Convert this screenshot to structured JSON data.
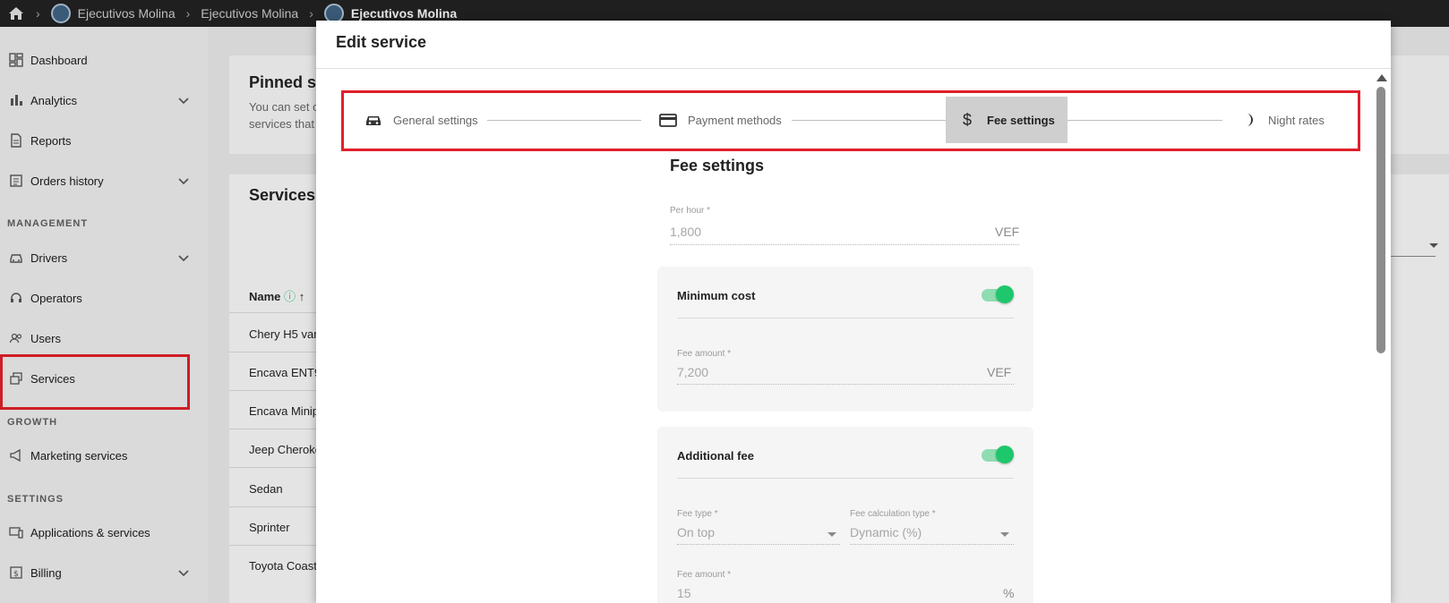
{
  "topbar": {
    "crumbs": [
      "Ejecutivos Molina",
      "Ejecutivos Molina",
      "Ejecutivos Molina"
    ]
  },
  "sidebar": {
    "items": [
      {
        "label": "Dashboard",
        "icon": "dashboard-icon"
      },
      {
        "label": "Analytics",
        "icon": "bar-chart-icon"
      },
      {
        "label": "Reports",
        "icon": "document-icon"
      },
      {
        "label": "Orders history",
        "icon": "list-icon"
      },
      {
        "label": "Drivers",
        "icon": "car-icon"
      },
      {
        "label": "Operators",
        "icon": "headset-icon"
      },
      {
        "label": "Users",
        "icon": "users-icon"
      },
      {
        "label": "Services",
        "icon": "services-icon"
      },
      {
        "label": "Marketing services",
        "icon": "megaphone-icon"
      },
      {
        "label": "Applications & services",
        "icon": "devices-icon"
      },
      {
        "label": "Billing",
        "icon": "billing-icon"
      }
    ],
    "sections": [
      "MANAGEMENT",
      "GROWTH",
      "SETTINGS"
    ]
  },
  "background": {
    "pinned_title": "Pinned s",
    "pinned_desc_1": "You can set o",
    "pinned_desc_2": "services that",
    "services_title": "Services",
    "name_header": "Name",
    "rows": [
      "Chery H5 var",
      "Encava ENT9",
      "Encava Minip",
      "Jeep Cheroke",
      "Sedan",
      "Sprinter",
      "Toyota Coast"
    ]
  },
  "modal": {
    "title": "Edit service",
    "steps": [
      "General settings",
      "Payment methods",
      "Fee settings",
      "Night rates"
    ],
    "section_title": "Fee settings",
    "per_hour": {
      "label": "Per hour *",
      "value": "1,800",
      "unit": "VEF"
    },
    "minimum_cost": {
      "title": "Minimum cost",
      "fee_label": "Fee amount *",
      "fee_value": "7,200",
      "unit": "VEF",
      "enabled": true
    },
    "additional_fee": {
      "title": "Additional fee",
      "enabled": true,
      "fee_type_label": "Fee type *",
      "fee_type_value": "On top",
      "calc_type_label": "Fee calculation type *",
      "calc_type_value": "Dynamic (%)",
      "fee_label": "Fee amount *",
      "fee_value": "15",
      "unit": "%"
    }
  },
  "colors": {
    "highlight": "#e0202a",
    "toggle_on": "#1ec76b",
    "topbar": "#1f1f1f"
  }
}
